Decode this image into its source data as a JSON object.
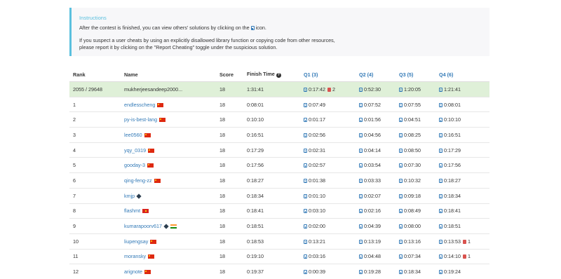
{
  "instructions": {
    "title": "Instructions",
    "line1_before": "After the contest is finished, you can view others' solutions by clicking on the",
    "line1_after": "icon.",
    "line2": "If you suspect a user cheats by using an explicitly disallowed library function or copying code from other resources,",
    "line3": "please report it by clicking on the \"Report Cheating\" toggle under the suspicious solution."
  },
  "table": {
    "headers": {
      "rank": "Rank",
      "name": "Name",
      "score": "Score",
      "finish_time": "Finish Time",
      "q1": "Q1 (3)",
      "q2": "Q2 (4)",
      "q3": "Q3 (5)",
      "q4": "Q4 (6)"
    },
    "rows": [
      {
        "rank": "2055 / 29648",
        "name": "mukherjeesandeep2000...",
        "flags": [],
        "score": "18",
        "finish": "1:31:41",
        "q1": "0:17:42",
        "q1_bugs": "2",
        "q2": "0:52:30",
        "q2_bugs": "",
        "q3": "1:20:05",
        "q3_bugs": "",
        "q4": "1:21:41",
        "q4_bugs": "",
        "highlight": true
      },
      {
        "rank": "1",
        "name": "endlesscheng",
        "flags": [
          "cn"
        ],
        "score": "18",
        "finish": "0:08:01",
        "q1": "0:07:49",
        "q1_bugs": "",
        "q2": "0:07:52",
        "q2_bugs": "",
        "q3": "0:07:55",
        "q3_bugs": "",
        "q4": "0:08:01",
        "q4_bugs": ""
      },
      {
        "rank": "2",
        "name": "py-is-best-lang",
        "flags": [
          "cn"
        ],
        "score": "18",
        "finish": "0:10:10",
        "q1": "0:01:17",
        "q1_bugs": "",
        "q2": "0:01:56",
        "q2_bugs": "",
        "q3": "0:04:51",
        "q3_bugs": "",
        "q4": "0:10:10",
        "q4_bugs": ""
      },
      {
        "rank": "3",
        "name": "lee0560",
        "flags": [
          "cn"
        ],
        "score": "18",
        "finish": "0:16:51",
        "q1": "0:02:56",
        "q1_bugs": "",
        "q2": "0:04:56",
        "q2_bugs": "",
        "q3": "0:08:25",
        "q3_bugs": "",
        "q4": "0:16:51",
        "q4_bugs": ""
      },
      {
        "rank": "4",
        "name": "yqy_0319",
        "flags": [
          "cn"
        ],
        "score": "18",
        "finish": "0:17:29",
        "q1": "0:02:31",
        "q1_bugs": "",
        "q2": "0:04:14",
        "q2_bugs": "",
        "q3": "0:08:50",
        "q3_bugs": "",
        "q4": "0:17:29",
        "q4_bugs": ""
      },
      {
        "rank": "5",
        "name": "gooday-3",
        "flags": [
          "cn"
        ],
        "score": "18",
        "finish": "0:17:56",
        "q1": "0:02:57",
        "q1_bugs": "",
        "q2": "0:03:54",
        "q2_bugs": "",
        "q3": "0:07:30",
        "q3_bugs": "",
        "q4": "0:17:56",
        "q4_bugs": ""
      },
      {
        "rank": "6",
        "name": "qing-feng-zz",
        "flags": [
          "cn"
        ],
        "score": "18",
        "finish": "0:18:27",
        "q1": "0:01:38",
        "q1_bugs": "",
        "q2": "0:03:33",
        "q2_bugs": "",
        "q3": "0:10:32",
        "q3_bugs": "",
        "q4": "0:18:27",
        "q4_bugs": ""
      },
      {
        "rank": "7",
        "name": "kmjp",
        "flags": [
          "globe"
        ],
        "score": "18",
        "finish": "0:18:34",
        "q1": "0:01:10",
        "q1_bugs": "",
        "q2": "0:02:07",
        "q2_bugs": "",
        "q3": "0:09:18",
        "q3_bugs": "",
        "q4": "0:18:34",
        "q4_bugs": ""
      },
      {
        "rank": "8",
        "name": "flashmt",
        "flags": [
          "vn"
        ],
        "score": "18",
        "finish": "0:18:41",
        "q1": "0:03:10",
        "q1_bugs": "",
        "q2": "0:02:16",
        "q2_bugs": "",
        "q3": "0:08:49",
        "q3_bugs": "",
        "q4": "0:18:41",
        "q4_bugs": ""
      },
      {
        "rank": "9",
        "name": "kumarapoorv617",
        "flags": [
          "globe",
          "in"
        ],
        "score": "18",
        "finish": "0:18:51",
        "q1": "0:02:00",
        "q1_bugs": "",
        "q2": "0:04:39",
        "q2_bugs": "",
        "q3": "0:08:00",
        "q3_bugs": "",
        "q4": "0:18:51",
        "q4_bugs": ""
      },
      {
        "rank": "10",
        "name": "liupengsay",
        "flags": [
          "cn"
        ],
        "score": "18",
        "finish": "0:18:53",
        "q1": "0:13:21",
        "q1_bugs": "",
        "q2": "0:13:19",
        "q2_bugs": "",
        "q3": "0:13:16",
        "q3_bugs": "",
        "q4": "0:13:53",
        "q4_bugs": "1"
      },
      {
        "rank": "11",
        "name": "moransky",
        "flags": [
          "cn"
        ],
        "score": "18",
        "finish": "0:19:10",
        "q1": "0:03:16",
        "q1_bugs": "",
        "q2": "0:04:48",
        "q2_bugs": "",
        "q3": "0:07:34",
        "q3_bugs": "",
        "q4": "0:14:10",
        "q4_bugs": "1"
      },
      {
        "rank": "12",
        "name": "arignote",
        "flags": [
          "cn"
        ],
        "score": "18",
        "finish": "0:19:37",
        "q1": "0:00:39",
        "q1_bugs": "",
        "q2": "0:19:28",
        "q2_bugs": "",
        "q3": "0:18:34",
        "q3_bugs": "",
        "q4": "0:19:24",
        "q4_bugs": ""
      }
    ]
  }
}
